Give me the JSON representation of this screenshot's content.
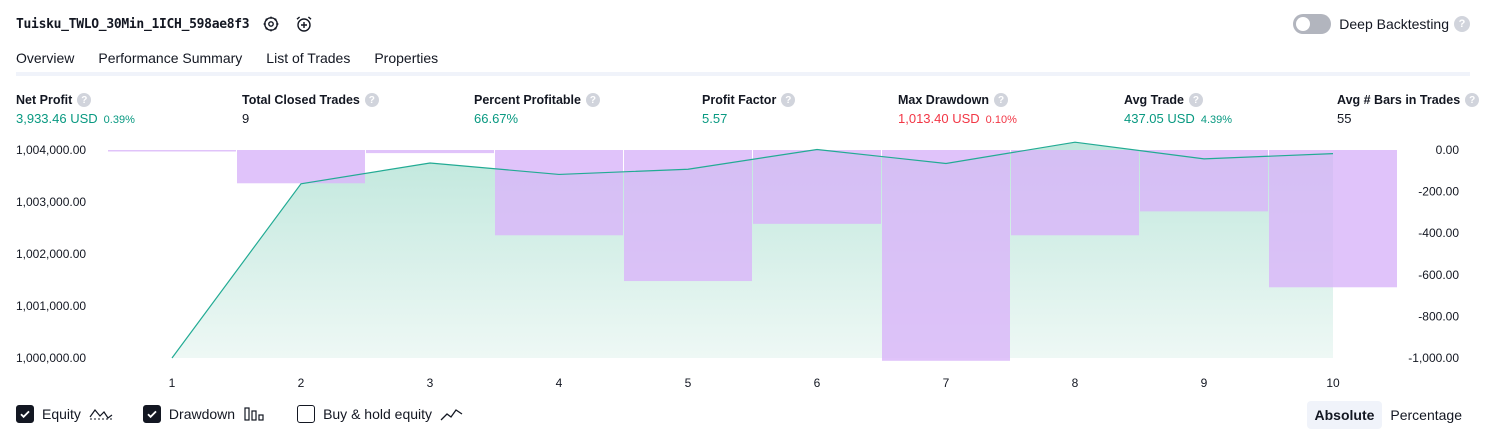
{
  "header": {
    "strategy_name": "Tuisku_TWLO_30Min_1ICH_598ae8f3",
    "deep_backtesting_label": "Deep Backtesting",
    "deep_backtesting_enabled": false
  },
  "tabs": [
    {
      "label": "Overview",
      "active": true
    },
    {
      "label": "Performance Summary",
      "active": false
    },
    {
      "label": "List of Trades",
      "active": false
    },
    {
      "label": "Properties",
      "active": false
    }
  ],
  "metrics": [
    {
      "label": "Net Profit",
      "value": "3,933.46 USD",
      "pct": "0.39%",
      "tone": "green"
    },
    {
      "label": "Total Closed Trades",
      "value": "9",
      "pct": "",
      "tone": "dark"
    },
    {
      "label": "Percent Profitable",
      "value": "66.67%",
      "pct": "",
      "tone": "green"
    },
    {
      "label": "Profit Factor",
      "value": "5.57",
      "pct": "",
      "tone": "green"
    },
    {
      "label": "Max Drawdown",
      "value": "1,013.40 USD",
      "pct": "0.10%",
      "tone": "red"
    },
    {
      "label": "Avg Trade",
      "value": "437.05 USD",
      "pct": "4.39%",
      "tone": "green"
    },
    {
      "label": "Avg # Bars in Trades",
      "value": "55",
      "pct": "",
      "tone": "dark"
    }
  ],
  "chart_data": {
    "type": "area",
    "x": [
      1,
      2,
      3,
      4,
      5,
      6,
      7,
      8,
      9,
      10
    ],
    "left_axis": {
      "ticks": [
        "1,004,000.00",
        "1,003,000.00",
        "1,002,000.00",
        "1,001,000.00",
        "1,000,000.00"
      ],
      "range": [
        1000000,
        1004000
      ]
    },
    "right_axis": {
      "ticks": [
        "0.00",
        "-200.00",
        "-400.00",
        "-600.00",
        "-800.00",
        "-1,000.00"
      ],
      "range": [
        -1000,
        0
      ]
    },
    "series": [
      {
        "name": "Equity",
        "kind": "area",
        "axis": "left",
        "values": [
          1000000,
          1003350,
          1003750,
          1003530,
          1003630,
          1004010,
          1003740,
          1004150,
          1003830,
          1003930
        ]
      },
      {
        "name": "Drawdown",
        "kind": "bar",
        "axis": "right",
        "values": [
          -5,
          -160,
          -15,
          -410,
          -630,
          -355,
          -1013.4,
          -410,
          -295,
          -660
        ]
      }
    ],
    "colors": {
      "equity_line": "#22ab94",
      "equity_fill_top": "#bfe7dc",
      "equity_fill_bottom": "#eef8f5",
      "drawdown_bar": "#d9b6f9",
      "overlap": "#a9b5e4"
    }
  },
  "legend": [
    {
      "label": "Equity",
      "checked": true,
      "icon": "equity-wave-icon"
    },
    {
      "label": "Drawdown",
      "checked": true,
      "icon": "drawdown-bars-icon"
    },
    {
      "label": "Buy & hold equity",
      "checked": false,
      "icon": "buy-hold-line-icon"
    }
  ],
  "view_modes": [
    {
      "label": "Absolute",
      "active": true
    },
    {
      "label": "Percentage",
      "active": false
    }
  ]
}
